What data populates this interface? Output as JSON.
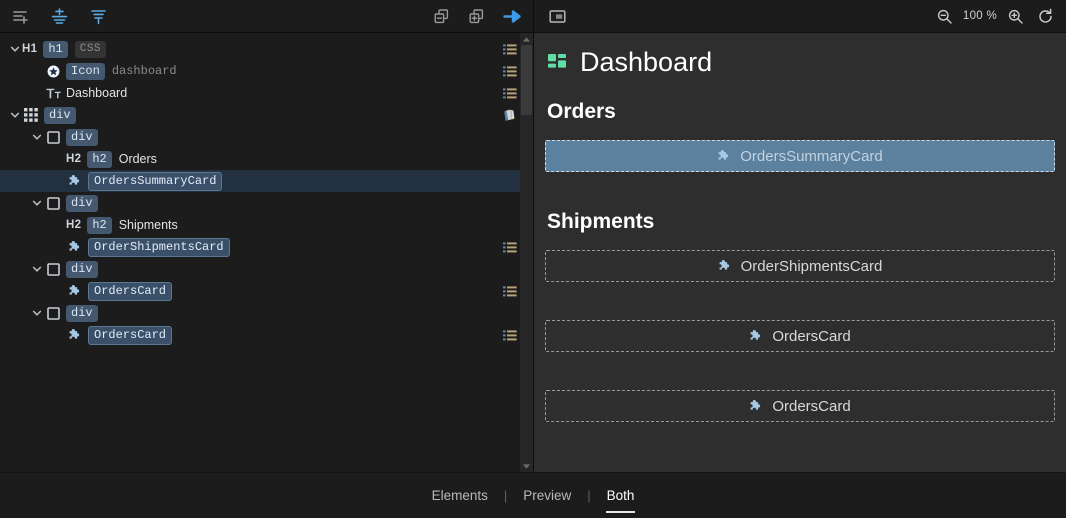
{
  "left_toolbar": {
    "buttons": [
      {
        "name": "add-element-button",
        "icon": "list-plus-icon",
        "color": "#9a9a9a"
      },
      {
        "name": "insert-above-button",
        "icon": "insert-above-icon",
        "color": "#5aa9e6"
      },
      {
        "name": "insert-below-button",
        "icon": "insert-below-icon",
        "color": "#5aa9e6"
      }
    ],
    "right_buttons": [
      {
        "name": "collapse-all-button",
        "icon": "collapse-all-icon",
        "color": "#9a9a9a"
      },
      {
        "name": "expand-all-button",
        "icon": "expand-all-icon",
        "color": "#9a9a9a"
      },
      {
        "name": "go-forward-button",
        "icon": "arrow-right-icon",
        "color": "#3d9ae8"
      }
    ]
  },
  "right_toolbar": {
    "panel_toggle": {
      "name": "panel-layout-button",
      "icon": "panel-icon"
    },
    "zoom_out": {
      "name": "zoom-out-button",
      "icon": "zoom-out-icon"
    },
    "zoom_level": "100 %",
    "zoom_in": {
      "name": "zoom-in-button",
      "icon": "zoom-in-icon"
    },
    "refresh": {
      "name": "refresh-button",
      "icon": "refresh-icon"
    }
  },
  "tree": {
    "rows": [
      {
        "id": "h1",
        "indent": 0,
        "twisty": "down",
        "type_icon": "none",
        "tag_label": "H1",
        "badge": "h1",
        "badge2": "CSS",
        "text": "",
        "dim_text": "",
        "selected": false,
        "action_icon": "list-menu-icon"
      },
      {
        "id": "icon-dashboard",
        "indent": 1,
        "twisty": "none",
        "type_icon": "star-icon",
        "tag_label": "",
        "badge": "Icon",
        "badge2": "",
        "text": "",
        "dim_text": "dashboard",
        "selected": false,
        "action_icon": "list-menu-icon"
      },
      {
        "id": "text-dashboard",
        "indent": 1,
        "twisty": "none",
        "type_icon": "text-icon",
        "tag_label": "",
        "badge": "",
        "badge2": "",
        "text": "Dashboard",
        "dim_text": "",
        "selected": false,
        "action_icon": "list-menu-icon"
      },
      {
        "id": "div-grid",
        "indent": 0,
        "twisty": "down",
        "type_icon": "grid-icon",
        "tag_label": "",
        "badge": "div",
        "badge2": "",
        "text": "",
        "dim_text": "",
        "selected": false,
        "action_icon": "books-icon"
      },
      {
        "id": "div-orders",
        "indent": 1,
        "twisty": "down",
        "type_icon": "square-icon",
        "tag_label": "",
        "badge": "div",
        "badge2": "",
        "text": "",
        "dim_text": "",
        "selected": false,
        "action_icon": "none"
      },
      {
        "id": "h2-orders",
        "indent": 2,
        "twisty": "none",
        "type_icon": "none",
        "tag_label": "H2",
        "badge": "h2",
        "badge2": "",
        "text": "Orders",
        "dim_text": "",
        "selected": false,
        "action_icon": "none"
      },
      {
        "id": "comp-orders-summary-card",
        "indent": 2,
        "twisty": "none",
        "type_icon": "puzzle-icon",
        "tag_label": "",
        "badge_component": "OrdersSummaryCard",
        "text": "",
        "dim_text": "",
        "selected": true,
        "action_icon": "none"
      },
      {
        "id": "div-shipments",
        "indent": 1,
        "twisty": "down",
        "type_icon": "square-icon",
        "tag_label": "",
        "badge": "div",
        "badge2": "",
        "text": "",
        "dim_text": "",
        "selected": false,
        "action_icon": "none"
      },
      {
        "id": "h2-shipments",
        "indent": 2,
        "twisty": "none",
        "type_icon": "none",
        "tag_label": "H2",
        "badge": "h2",
        "badge2": "",
        "text": "Shipments",
        "dim_text": "",
        "selected": false,
        "action_icon": "none"
      },
      {
        "id": "comp-order-shipments-card",
        "indent": 2,
        "twisty": "none",
        "type_icon": "puzzle-icon",
        "tag_label": "",
        "badge_component": "OrderShipmentsCard",
        "text": "",
        "dim_text": "",
        "selected": false,
        "action_icon": "list-menu-icon"
      },
      {
        "id": "div-orders-card-1",
        "indent": 1,
        "twisty": "down",
        "type_icon": "square-icon",
        "tag_label": "",
        "badge": "div",
        "badge2": "",
        "text": "",
        "dim_text": "",
        "selected": false,
        "action_icon": "none"
      },
      {
        "id": "comp-orders-card-1",
        "indent": 2,
        "twisty": "none",
        "type_icon": "puzzle-icon",
        "tag_label": "",
        "badge_component": "OrdersCard",
        "text": "",
        "dim_text": "",
        "selected": false,
        "action_icon": "list-menu-icon"
      },
      {
        "id": "div-orders-card-2",
        "indent": 1,
        "twisty": "down",
        "type_icon": "square-icon",
        "tag_label": "",
        "badge": "div",
        "badge2": "",
        "text": "",
        "dim_text": "",
        "selected": false,
        "action_icon": "none"
      },
      {
        "id": "comp-orders-card-2",
        "indent": 2,
        "twisty": "none",
        "type_icon": "puzzle-icon",
        "tag_label": "",
        "badge_component": "OrdersCard",
        "text": "",
        "dim_text": "",
        "selected": false,
        "action_icon": "list-menu-icon"
      }
    ]
  },
  "preview": {
    "title": "Dashboard",
    "title_icon": "dashboard-grid-icon",
    "title_icon_color": "#5fdfa6",
    "sections": [
      {
        "heading": "Orders",
        "cards": [
          {
            "label": "OrdersSummaryCard",
            "icon": "puzzle-icon",
            "selected": true
          }
        ]
      },
      {
        "heading": "Shipments",
        "cards": [
          {
            "label": "OrderShipmentsCard",
            "icon": "puzzle-icon",
            "selected": false
          }
        ]
      },
      {
        "heading": "",
        "cards": [
          {
            "label": "OrdersCard",
            "icon": "puzzle-icon",
            "selected": false
          }
        ]
      },
      {
        "heading": "",
        "cards": [
          {
            "label": "OrdersCard",
            "icon": "puzzle-icon",
            "selected": false
          }
        ]
      }
    ]
  },
  "tabs": [
    {
      "label": "Elements",
      "active": false
    },
    {
      "label": "Preview",
      "active": false
    },
    {
      "label": "Both",
      "active": true
    }
  ],
  "colors": {
    "tree_bg": "#1c1c1c",
    "preview_bg": "#2e2e2e",
    "selection": "#23303f",
    "accent_blue": "#5aa9e6",
    "badge_blue": "#44586f",
    "card_selected": "#5b819f"
  }
}
